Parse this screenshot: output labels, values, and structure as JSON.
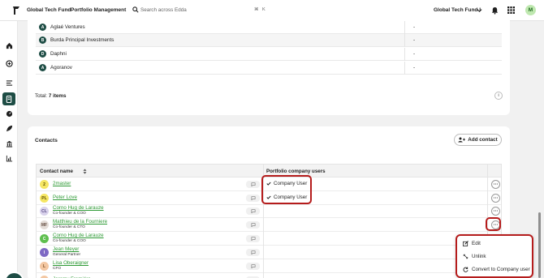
{
  "header": {
    "fund_name": "Global Tech Fund",
    "portfolio_link": "Portfolio Management",
    "search_placeholder": "Search across Edda",
    "kbd_cmd": "⌘",
    "kbd_k": "K",
    "fund_select": "Global Tech Fund I",
    "avatar_initial": "M"
  },
  "investors": {
    "rows": [
      {
        "initial": "A",
        "name": "Aglaé Ventures",
        "value": "-"
      },
      {
        "initial": "B",
        "name": "Burda Principal Investments",
        "value": "-"
      },
      {
        "initial": "D",
        "name": "Daphni",
        "value": "-"
      },
      {
        "initial": "A",
        "name": "Agoranov",
        "value": "-"
      }
    ],
    "total_label": "Total:",
    "total_value": "7 items",
    "info_icon": "i"
  },
  "contacts": {
    "title": "Contacts",
    "add_button": "Add contact",
    "col_name": "Contact name",
    "col_company_users": "Portfolio company users",
    "rows": [
      {
        "initial": "2",
        "name": "2master",
        "sub": "",
        "company_user": "Company User",
        "avatar_bg": "#f5e663",
        "avatar_fg": "#5a4a00"
      },
      {
        "initial": "PL",
        "name": "Peter Love",
        "sub": "",
        "company_user": "Company User",
        "avatar_bg": "#f5e663",
        "avatar_fg": "#5a4a00"
      },
      {
        "initial": "CL",
        "name": "Corno Hug de Larauze",
        "sub": "Co-founder & COO",
        "company_user": "",
        "avatar_bg": "#d9d2ec",
        "avatar_fg": "#5b4d87"
      },
      {
        "initial": "MF",
        "name": "Matthieu de la Fourniere",
        "sub": "Co-founder & CTO",
        "company_user": "",
        "avatar_bg": "#e4ddd8",
        "avatar_fg": "#6b5549"
      },
      {
        "initial": "C",
        "name": "Corno Hug de Larauze",
        "sub": "Co-founder & COO",
        "company_user": "",
        "avatar_bg": "#5fbf4f",
        "avatar_fg": "#ffffff"
      },
      {
        "initial": "I",
        "name": "Jean Meyer",
        "sub": "General Partner",
        "company_user": "",
        "avatar_bg": "#7e69c4",
        "avatar_fg": "#ffffff"
      },
      {
        "initial": "L",
        "name": "Lisa Oberaigner",
        "sub": "CFO",
        "company_user": "",
        "avatar_bg": "#f3c7a2",
        "avatar_fg": "#7a4b22"
      },
      {
        "initial": "",
        "name": "Jeremy Fremiére",
        "sub": "",
        "company_user": "",
        "avatar_bg": "#f3c7a2",
        "avatar_fg": "#7a4b22"
      }
    ],
    "more_label": "···",
    "menu": {
      "edit": "Edit",
      "unlink": "Unlink",
      "convert": "Convert to Company user"
    }
  },
  "colors": {
    "accent_dark_green": "#1e4d45",
    "link_green": "#2e9a35",
    "highlight_red": "#b51c1c"
  }
}
